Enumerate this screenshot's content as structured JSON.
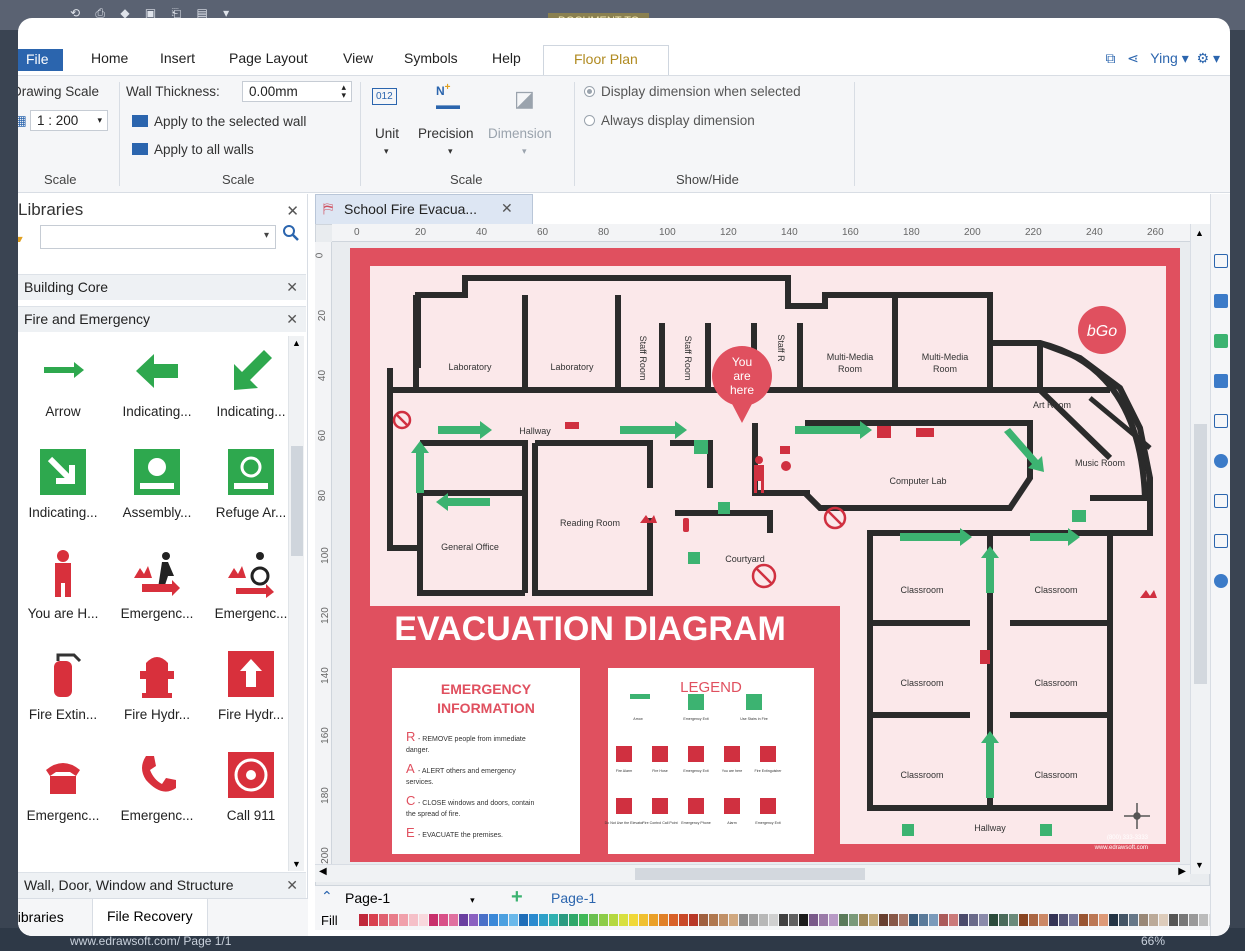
{
  "window": {
    "document_title": "DOCUMENT TO",
    "status_url": "www.edrawsoft.com/",
    "status_page": "Page 1/1",
    "zoom": "66%"
  },
  "ribbon": {
    "tabs": [
      "File",
      "Home",
      "Insert",
      "Page Layout",
      "View",
      "Symbols",
      "Help"
    ],
    "active_tab": "Floor Plan",
    "user": "Ying",
    "scale_group": {
      "drawing_scale_label": "Drawing Scale",
      "drawing_scale_value": "1 : 200",
      "label": "Scale"
    },
    "wall_group": {
      "wall_thickness_label": "Wall Thickness:",
      "wall_thickness_value": "0.00mm",
      "apply_selected": "Apply to the selected wall",
      "apply_all": "Apply to all walls",
      "label": "Scale"
    },
    "unit_group": {
      "unit": "Unit",
      "unit_icon_text": "012",
      "precision": "Precision",
      "dimension": "Dimension",
      "label": "Scale"
    },
    "showhide_group": {
      "opt1": "Display dimension when selected",
      "opt2": "Always display dimension",
      "label": "Show/Hide"
    }
  },
  "libraries": {
    "title": "Libraries",
    "categories": [
      "Building Core",
      "Fire and Emergency",
      "Wall, Door, Window and Structure"
    ],
    "shapes": [
      {
        "label": "Arrow",
        "icon": "arrow-right-icon"
      },
      {
        "label": "Indicating...",
        "icon": "arrow-left-icon"
      },
      {
        "label": "Indicating...",
        "icon": "arrow-diagonal-icon"
      },
      {
        "label": "Indicating...",
        "icon": "arrow-down-right-icon"
      },
      {
        "label": "Assembly...",
        "icon": "assembly-point-icon"
      },
      {
        "label": "Refuge Ar...",
        "icon": "refuge-area-icon"
      },
      {
        "label": "You are H...",
        "icon": "you-are-here-icon"
      },
      {
        "label": "Emergenc...",
        "icon": "emergency-exit-icon"
      },
      {
        "label": "Emergenc...",
        "icon": "emergency-exit-disabled-icon"
      },
      {
        "label": "Fire Extin...",
        "icon": "fire-extinguisher-icon"
      },
      {
        "label": "Fire Hydr...",
        "icon": "fire-hydrant-icon"
      },
      {
        "label": "Fire Hydr...",
        "icon": "fire-hydrant-sign-icon"
      },
      {
        "label": "Emergenc...",
        "icon": "emergency-phone-icon"
      },
      {
        "label": "Emergenc...",
        "icon": "emergency-handset-icon"
      },
      {
        "label": "Call 911",
        "icon": "call-911-icon"
      }
    ],
    "bottom_tabs": [
      "Libraries",
      "File Recovery"
    ]
  },
  "document": {
    "tab_title": "School Fire Evacua...",
    "ruler_h": [
      "0",
      "20",
      "40",
      "60",
      "80",
      "100",
      "120",
      "140",
      "160",
      "180",
      "200",
      "220",
      "240",
      "260"
    ],
    "ruler_v": [
      "0",
      "20",
      "40",
      "60",
      "80",
      "100",
      "120",
      "140",
      "160",
      "180",
      "200"
    ]
  },
  "diagram": {
    "title": "EVACUATION DIAGRAM",
    "logo": "bGo",
    "you_are_here": [
      "You",
      "are",
      "here"
    ],
    "rooms": {
      "lab1": "Laboratory",
      "lab2": "Laboratory",
      "staff1": "Staff Room",
      "staff2": "Staff Room",
      "staff3": "Staff R",
      "mm1": [
        "Multi-Media",
        "Room"
      ],
      "mm2": [
        "Multi-Media",
        "Room"
      ],
      "art": "Art Room",
      "music": "Music Room",
      "computer": "Computer Lab",
      "reading": "Reading Room",
      "office": "General Office",
      "courtyard": "Courtyard",
      "hallway_top": "Hallway",
      "hallway_bottom": "Hallway",
      "classroom": "Classroom"
    },
    "emergency": {
      "title": [
        "EMERGENCY",
        "INFORMATION"
      ],
      "items": [
        {
          "letter": "R",
          "text": "- REMOVE people from immediate danger."
        },
        {
          "letter": "A",
          "text": "- ALERT others and emergency services."
        },
        {
          "letter": "C",
          "text": "- CLOSE windows and doors, contain the spread of fire."
        },
        {
          "letter": "E",
          "text": "- EVACUATE the premises."
        }
      ]
    },
    "legend": {
      "title": "LEGEND",
      "row1": [
        "Arrow",
        "Emergency Exit",
        "Use Stairs in Fire"
      ],
      "row2": [
        "Fire Alarm",
        "Fire Hose",
        "Emergency Exit",
        "You are here",
        "Fire Extinguisher"
      ],
      "row3": [
        "Do Not Use the Elevator",
        "Fire Control Call Point",
        "Emergency Phone",
        "Alarm",
        "Emergency Exit"
      ]
    },
    "footer_phone": "(800) 333-3333",
    "footer_url": "www.edrawsoft.com"
  },
  "pages_bar": {
    "page_select": "Page-1",
    "page_tab": "Page-1",
    "fill_label": "Fill"
  },
  "colors": {
    "accent": "#2b65ae",
    "diagram_red": "#e0505f",
    "exit_green": "#3cb371",
    "wall": "#2b2b2b"
  }
}
